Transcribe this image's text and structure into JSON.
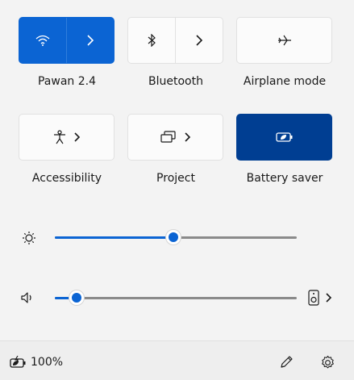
{
  "tiles": {
    "wifi": {
      "label": "Pawan 2.4",
      "state": "on",
      "icon": "wifi-icon",
      "chevron_icon": "chevron-right-icon"
    },
    "bluetooth": {
      "label": "Bluetooth",
      "state": "off",
      "icon": "bluetooth-icon",
      "chevron_icon": "chevron-right-icon"
    },
    "airplane": {
      "label": "Airplane mode",
      "state": "off",
      "icon": "airplane-icon"
    },
    "accessibility": {
      "label": "Accessibility",
      "state": "off",
      "icon": "accessibility-icon",
      "chevron_icon": "chevron-right-icon"
    },
    "project": {
      "label": "Project",
      "state": "off",
      "icon": "project-icon",
      "chevron_icon": "chevron-right-icon"
    },
    "battery_saver": {
      "label": "Battery saver",
      "state": "on",
      "icon": "battery-saver-icon"
    }
  },
  "sliders": {
    "brightness": {
      "icon": "brightness-icon",
      "value_fraction": 0.49
    },
    "volume": {
      "icon": "speaker-icon",
      "value_fraction": 0.09,
      "output_icon": "audio-output-icon",
      "chevron_icon": "chevron-right-icon"
    }
  },
  "footer": {
    "battery_icon": "battery-charging-icon",
    "battery_percent": "100%",
    "edit_icon": "pencil-icon",
    "settings_icon": "gear-icon"
  },
  "colors": {
    "accent": "#0b64d3",
    "accent_dark": "#003e92",
    "panel_bg": "#f3f3f3",
    "tile_bg": "#fbfbfb"
  }
}
